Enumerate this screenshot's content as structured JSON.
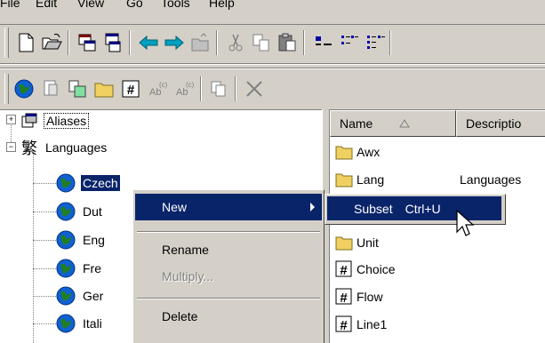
{
  "menubar": {
    "items": [
      "File",
      "Edit",
      "View",
      "Go",
      "Tools",
      "Help"
    ]
  },
  "toolbar1": {
    "icons": [
      "new-document-icon",
      "open-folder-icon",
      "properties-icon",
      "copy-window-icon",
      "back-icon",
      "forward-icon",
      "up-folder-icon",
      "cut-icon",
      "copy-icon",
      "paste-icon",
      "large-icons-icon",
      "small-icons-icon",
      "list-view-icon"
    ]
  },
  "toolbar2": {
    "icons": [
      "globe-icon",
      "document-icon",
      "paste-special-icon",
      "folder-icon",
      "hash-icon",
      "abc-superscript-icon",
      "abc-superscript-alt-icon",
      "duplicate-icon",
      "delete-x-icon"
    ]
  },
  "tree": {
    "aliases": "Aliases",
    "languages": "Languages",
    "children": [
      "Czech",
      "Dut",
      "Eng",
      "Fre",
      "Ger",
      "Itali"
    ]
  },
  "list": {
    "columns": [
      "Name",
      "Descriptio"
    ],
    "rows": [
      {
        "name": "Awx",
        "description": "",
        "icon": "folder-icon"
      },
      {
        "name": "Lang",
        "description": "Languages",
        "icon": "folder-icon"
      },
      {
        "name": "",
        "description": "",
        "icon": "folder-icon"
      },
      {
        "name": "Unit",
        "description": "",
        "icon": "folder-icon"
      },
      {
        "name": "Choice",
        "description": "",
        "icon": "hash-icon"
      },
      {
        "name": "Flow",
        "description": "",
        "icon": "hash-icon"
      },
      {
        "name": "Line1",
        "description": "",
        "icon": "hash-icon"
      }
    ]
  },
  "context_menu": {
    "new": "New",
    "rename": "Rename",
    "multiply": "Multiply...",
    "delete": "Delete"
  },
  "submenu": {
    "label": "Subset",
    "shortcut": "Ctrl+U"
  },
  "colors": {
    "selection": "#0a246a",
    "face": "#d4d0c8"
  }
}
